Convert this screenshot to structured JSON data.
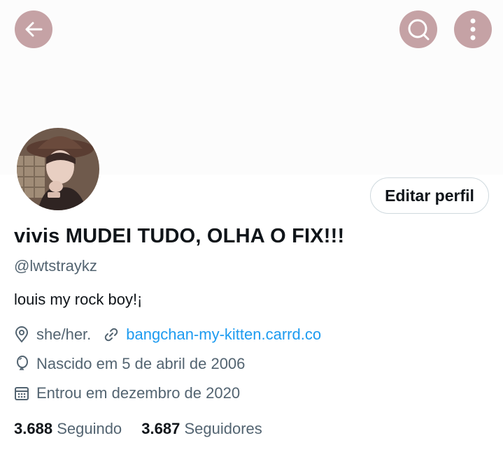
{
  "header": {
    "back_icon": "arrow-left-icon",
    "search_icon": "search-icon",
    "more_icon": "more-vertical-icon",
    "button_color": "#c5a2a5"
  },
  "profile": {
    "display_name": "vivis MUDEI TUDO, OLHA O FIX!!!",
    "handle": "@lwtstraykz",
    "bio": "louis my rock boy!¡",
    "edit_label": "Editar perfil",
    "pronouns": "she/her.",
    "website": "bangchan-my-kitten.carrd.co",
    "birthday": "Nascido em 5 de abril de 2006",
    "joined": "Entrou em dezembro de 2020"
  },
  "stats": {
    "following_count": "3.688",
    "following_label": "Seguindo",
    "followers_count": "3.687",
    "followers_label": "Seguidores"
  },
  "colors": {
    "link": "#1d9bf0",
    "secondary_text": "#536471",
    "primary_text": "#0f1419"
  }
}
